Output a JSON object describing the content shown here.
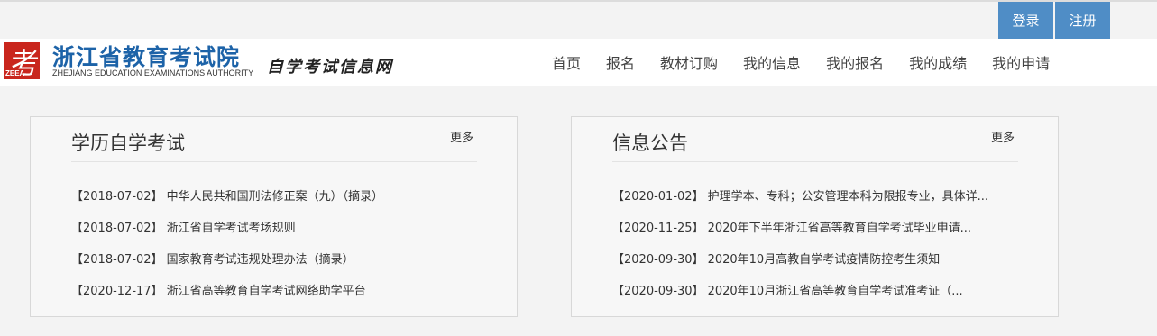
{
  "auth": {
    "login": "登录",
    "register": "注册"
  },
  "logo": {
    "char": "考",
    "abbr": "ZEEA",
    "title": "浙江省教育考试院",
    "subtitle": "ZHEJIANG EDUCATION EXAMINATIONS AUTHORITY",
    "tagline": "自学考试信息网"
  },
  "nav": [
    "首页",
    "报名",
    "教材订购",
    "我的信息",
    "我的报名",
    "我的成绩",
    "我的申请"
  ],
  "panels": [
    {
      "title": "学历自学考试",
      "more": "更多",
      "items": [
        {
          "date": "【2018-07-02】",
          "text": "中华人民共和国刑法修正案（九）（摘录）"
        },
        {
          "date": "【2018-07-02】",
          "text": "浙江省自学考试考场规则"
        },
        {
          "date": "【2018-07-02】",
          "text": "国家教育考试违规处理办法（摘录）"
        },
        {
          "date": "【2020-12-17】",
          "text": "浙江省高等教育自学考试网络助学平台"
        }
      ]
    },
    {
      "title": "信息公告",
      "more": "更多",
      "items": [
        {
          "date": "【2020-01-02】",
          "text": "护理学本、专科；公安管理本科为限报专业，具体详..."
        },
        {
          "date": "【2020-11-25】",
          "text": "2020年下半年浙江省高等教育自学考试毕业申请..."
        },
        {
          "date": "【2020-09-30】",
          "text": "2020年10月高教自学考试疫情防控考生须知"
        },
        {
          "date": "【2020-09-30】",
          "text": "2020年10月浙江省高等教育自学考试准考证（..."
        }
      ]
    }
  ]
}
